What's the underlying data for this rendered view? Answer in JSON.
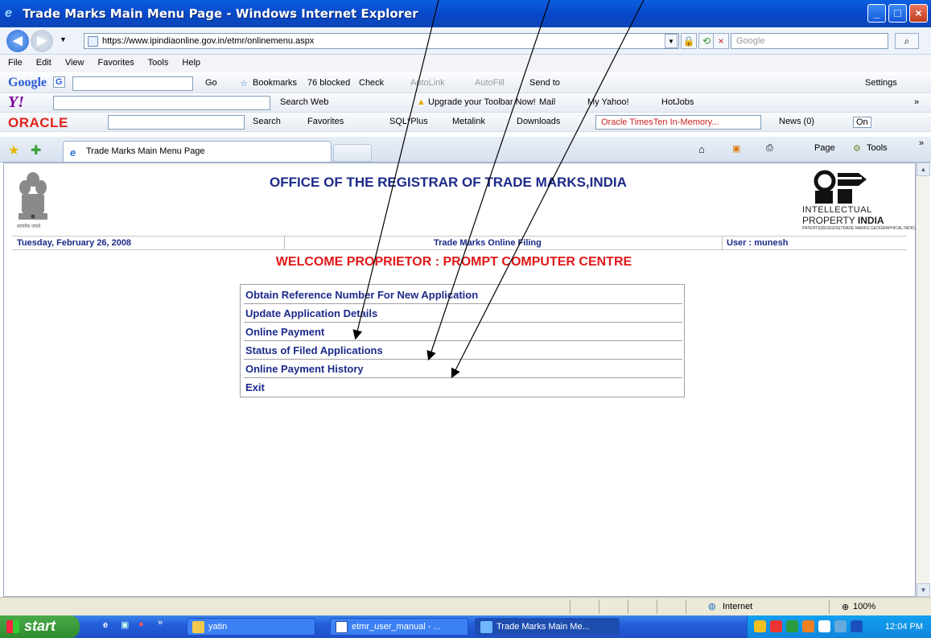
{
  "window": {
    "title": "Trade Marks Main Menu Page - Windows Internet Explorer",
    "min": "_",
    "max": "□",
    "close": "×"
  },
  "address_bar": {
    "url": "https://www.ipindiaonline.gov.in/etmr/onlinemenu.aspx",
    "search_placeholder": "Google"
  },
  "menubar": [
    "File",
    "Edit",
    "View",
    "Favorites",
    "Tools",
    "Help"
  ],
  "google_toolbar": {
    "logo": "Google",
    "g_btn": "G",
    "go": "Go",
    "bookmarks": "Bookmarks",
    "blocked": "76 blocked",
    "check": "Check",
    "autolink": "AutoLink",
    "autofill": "AutoFill",
    "send_to": "Send to",
    "settings": "Settings"
  },
  "yahoo_toolbar": {
    "logo": "Y!",
    "search_web": "Search Web",
    "upgrade": "Upgrade your Toolbar Now!",
    "mail": "Mail",
    "my_yahoo": "My Yahoo!",
    "hotjobs": "HotJobs"
  },
  "oracle_toolbar": {
    "logo": "ORACLE",
    "search": "Search",
    "favorites": "Favorites",
    "sqlplus": "SQL*Plus",
    "metalink": "Metalink",
    "downloads": "Downloads",
    "timesten": "Oracle TimesTen In-Memory...",
    "news": "News (0)",
    "on": "On"
  },
  "tabs": {
    "active_tab": "Trade Marks Main Menu Page",
    "page_cmd": "Page",
    "tools_cmd": "Tools"
  },
  "page": {
    "office_title": "OFFICE OF THE REGISTRAR OF TRADE MARKS,INDIA",
    "emblem_caption": "सत्यमेव जयते",
    "logo_line1": "INTELLECTUAL",
    "logo_line2_a": "PROPERTY ",
    "logo_line2_b": "INDIA",
    "logo_line3": "PATENTS|DESIGNS|TRADE MARKS GEOGRAPHICAL INDICATIONS",
    "date": "Tuesday, February 26, 2008",
    "filing": "Trade Marks Online Filing",
    "user": "User : munesh",
    "welcome": "WELCOME PROPRIETOR : PROMPT COMPUTER CENTRE",
    "menu": [
      "Obtain Reference Number For New Application",
      "Update Application Details",
      "Online Payment",
      "Status of Filed Applications",
      "Online Payment History",
      "Exit"
    ]
  },
  "statusbar": {
    "zone": "Internet",
    "zoom": "100%"
  },
  "taskbar": {
    "start": "start",
    "tasks": [
      "yatin",
      "etmr_user_manual - ...",
      "Trade Marks Main Me..."
    ],
    "clock": "12:04 PM"
  },
  "colors": {
    "link_blue": "#1b2a8a",
    "welcome_red": "#e01818",
    "xp_blue": "#0a5ee0"
  }
}
